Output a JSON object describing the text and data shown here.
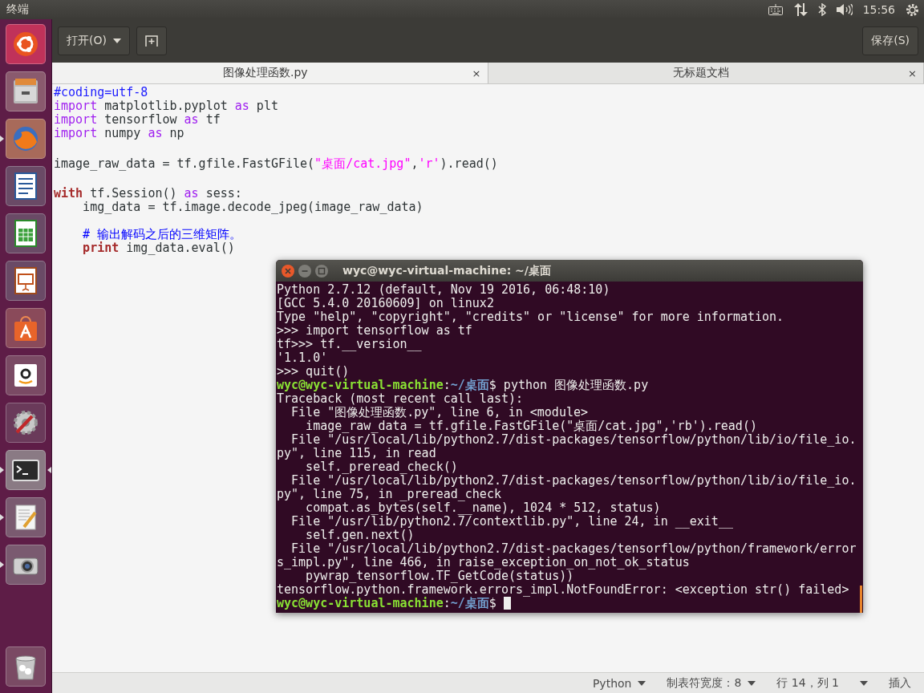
{
  "top_panel": {
    "title": "终端",
    "clock": "15:56"
  },
  "launcher": [
    {
      "kind": "dash",
      "running": false,
      "focused": false
    },
    {
      "kind": "files",
      "running": false,
      "focused": false
    },
    {
      "kind": "browser",
      "running": true,
      "focused": false
    },
    {
      "kind": "writer",
      "running": false,
      "focused": false
    },
    {
      "kind": "calc",
      "running": false,
      "focused": false
    },
    {
      "kind": "impress",
      "running": false,
      "focused": false
    },
    {
      "kind": "software",
      "running": false,
      "focused": false
    },
    {
      "kind": "shop",
      "running": false,
      "focused": false
    },
    {
      "kind": "settings",
      "running": false,
      "focused": false
    },
    {
      "kind": "terminal",
      "running": true,
      "focused": true
    },
    {
      "kind": "editor",
      "running": true,
      "focused": false
    },
    {
      "kind": "camera",
      "running": true,
      "focused": false
    },
    {
      "kind": "trash",
      "running": false,
      "focused": false
    }
  ],
  "editor_window": {
    "open_button": "打开(O)",
    "save_button": "保存(S)",
    "tabs": [
      {
        "label": "图像处理函数.py",
        "close": "×",
        "selected": true
      },
      {
        "label": "无标题文档",
        "close": "×",
        "selected": false
      }
    ],
    "code": [
      {
        "kind": "code",
        "tokens": [
          {
            "text": "#coding=utf-8",
            "kind": "preproc"
          }
        ]
      },
      {
        "kind": "code",
        "tokens": [
          {
            "text": "import",
            "kind": "keyword"
          },
          {
            "text": " matplotlib.pyplot ",
            "kind": "plain"
          },
          {
            "text": "as",
            "kind": "keyword"
          },
          {
            "text": " plt",
            "kind": "plain"
          }
        ]
      },
      {
        "kind": "code",
        "tokens": [
          {
            "text": "import",
            "kind": "keyword"
          },
          {
            "text": " tensorflow ",
            "kind": "plain"
          },
          {
            "text": "as",
            "kind": "keyword"
          },
          {
            "text": " tf",
            "kind": "plain"
          }
        ]
      },
      {
        "kind": "code",
        "tokens": [
          {
            "text": "import",
            "kind": "keyword"
          },
          {
            "text": " numpy ",
            "kind": "plain"
          },
          {
            "text": "as",
            "kind": "keyword"
          },
          {
            "text": " np",
            "kind": "plain"
          }
        ]
      },
      {
        "kind": "blank"
      },
      {
        "kind": "code",
        "tokens": [
          {
            "text": "image_raw_data = tf.gfile.FastGFile(",
            "kind": "plain"
          },
          {
            "text": "\"桌面/cat.jpg\"",
            "kind": "string"
          },
          {
            "text": ",",
            "kind": "plain"
          },
          {
            "text": "'r'",
            "kind": "string"
          },
          {
            "text": ").read()",
            "kind": "plain"
          }
        ]
      },
      {
        "kind": "blank"
      },
      {
        "kind": "code",
        "tokens": [
          {
            "text": "with",
            "kind": "statement"
          },
          {
            "text": " tf.Session() ",
            "kind": "plain"
          },
          {
            "text": "as",
            "kind": "keyword"
          },
          {
            "text": " sess:",
            "kind": "plain"
          }
        ]
      },
      {
        "kind": "code",
        "tokens": [
          {
            "text": "    img_data = tf.image.decode_jpeg(image_raw_data)",
            "kind": "plain"
          }
        ]
      },
      {
        "kind": "blank"
      },
      {
        "kind": "code",
        "tokens": [
          {
            "text": "    # 输出解码之后的三维矩阵。",
            "kind": "comment"
          }
        ]
      },
      {
        "kind": "code",
        "tokens": [
          {
            "text": "    print",
            "kind": "statement"
          },
          {
            "text": " img_data.eval()",
            "kind": "plain"
          }
        ]
      }
    ],
    "status_bar": {
      "language": "Python",
      "tab_width": "制表符宽度：8",
      "position": "行 14，列 1",
      "mode": "插入"
    }
  },
  "terminal": {
    "title": "wyc@wyc-virtual-machine: ~/桌面",
    "cursor": true,
    "lines": [
      [
        {
          "text": "Python 2.7.12 (default, Nov 19 2016, 06:48:10)",
          "kind": "plain"
        }
      ],
      [
        {
          "text": "[GCC 5.4.0 20160609] on linux2",
          "kind": "plain"
        }
      ],
      [
        {
          "text": "Type \"help\", \"copyright\", \"credits\" or \"license\" for more information.",
          "kind": "plain"
        }
      ],
      [
        {
          "text": ">>> import tensorflow as tf",
          "kind": "plain"
        }
      ],
      [
        {
          "text": "tf>>> tf.__version__",
          "kind": "plain"
        }
      ],
      [
        {
          "text": "'1.1.0'",
          "kind": "plain"
        }
      ],
      [
        {
          "text": ">>> quit()",
          "kind": "plain"
        }
      ],
      [
        {
          "text": "wyc@wyc-virtual-machine",
          "kind": "user"
        },
        {
          "text": ":",
          "kind": "plain"
        },
        {
          "text": "~/桌面",
          "kind": "path"
        },
        {
          "text": "$ python 图像处理函数.py",
          "kind": "plain"
        }
      ],
      [
        {
          "text": "Traceback (most recent call last):",
          "kind": "plain"
        }
      ],
      [
        {
          "text": "  File \"图像处理函数.py\", line 6, in <module>",
          "kind": "plain"
        }
      ],
      [
        {
          "text": "    image_raw_data = tf.gfile.FastGFile(\"桌面/cat.jpg\",'rb').read()",
          "kind": "plain"
        }
      ],
      [
        {
          "text": "  File \"/usr/local/lib/python2.7/dist-packages/tensorflow/python/lib/io/file_io.",
          "kind": "plain"
        }
      ],
      [
        {
          "text": "py\", line 115, in read",
          "kind": "plain"
        }
      ],
      [
        {
          "text": "    self._preread_check()",
          "kind": "plain"
        }
      ],
      [
        {
          "text": "  File \"/usr/local/lib/python2.7/dist-packages/tensorflow/python/lib/io/file_io.",
          "kind": "plain"
        }
      ],
      [
        {
          "text": "py\", line 75, in _preread_check",
          "kind": "plain"
        }
      ],
      [
        {
          "text": "    compat.as_bytes(self.__name), 1024 * 512, status)",
          "kind": "plain"
        }
      ],
      [
        {
          "text": "  File \"/usr/lib/python2.7/contextlib.py\", line 24, in __exit__",
          "kind": "plain"
        }
      ],
      [
        {
          "text": "    self.gen.next()",
          "kind": "plain"
        }
      ],
      [
        {
          "text": "  File \"/usr/local/lib/python2.7/dist-packages/tensorflow/python/framework/error",
          "kind": "plain"
        }
      ],
      [
        {
          "text": "s_impl.py\", line 466, in raise_exception_on_not_ok_status",
          "kind": "plain"
        }
      ],
      [
        {
          "text": "    pywrap_tensorflow.TF_GetCode(status))",
          "kind": "plain"
        }
      ],
      [
        {
          "text": "tensorflow.python.framework.errors_impl.NotFoundError: <exception str() failed>",
          "kind": "plain"
        }
      ],
      [
        {
          "text": "wyc@wyc-virtual-machine",
          "kind": "user"
        },
        {
          "text": ":",
          "kind": "plain"
        },
        {
          "text": "~/桌面",
          "kind": "path"
        },
        {
          "text": "$ ",
          "kind": "plain"
        }
      ]
    ]
  }
}
